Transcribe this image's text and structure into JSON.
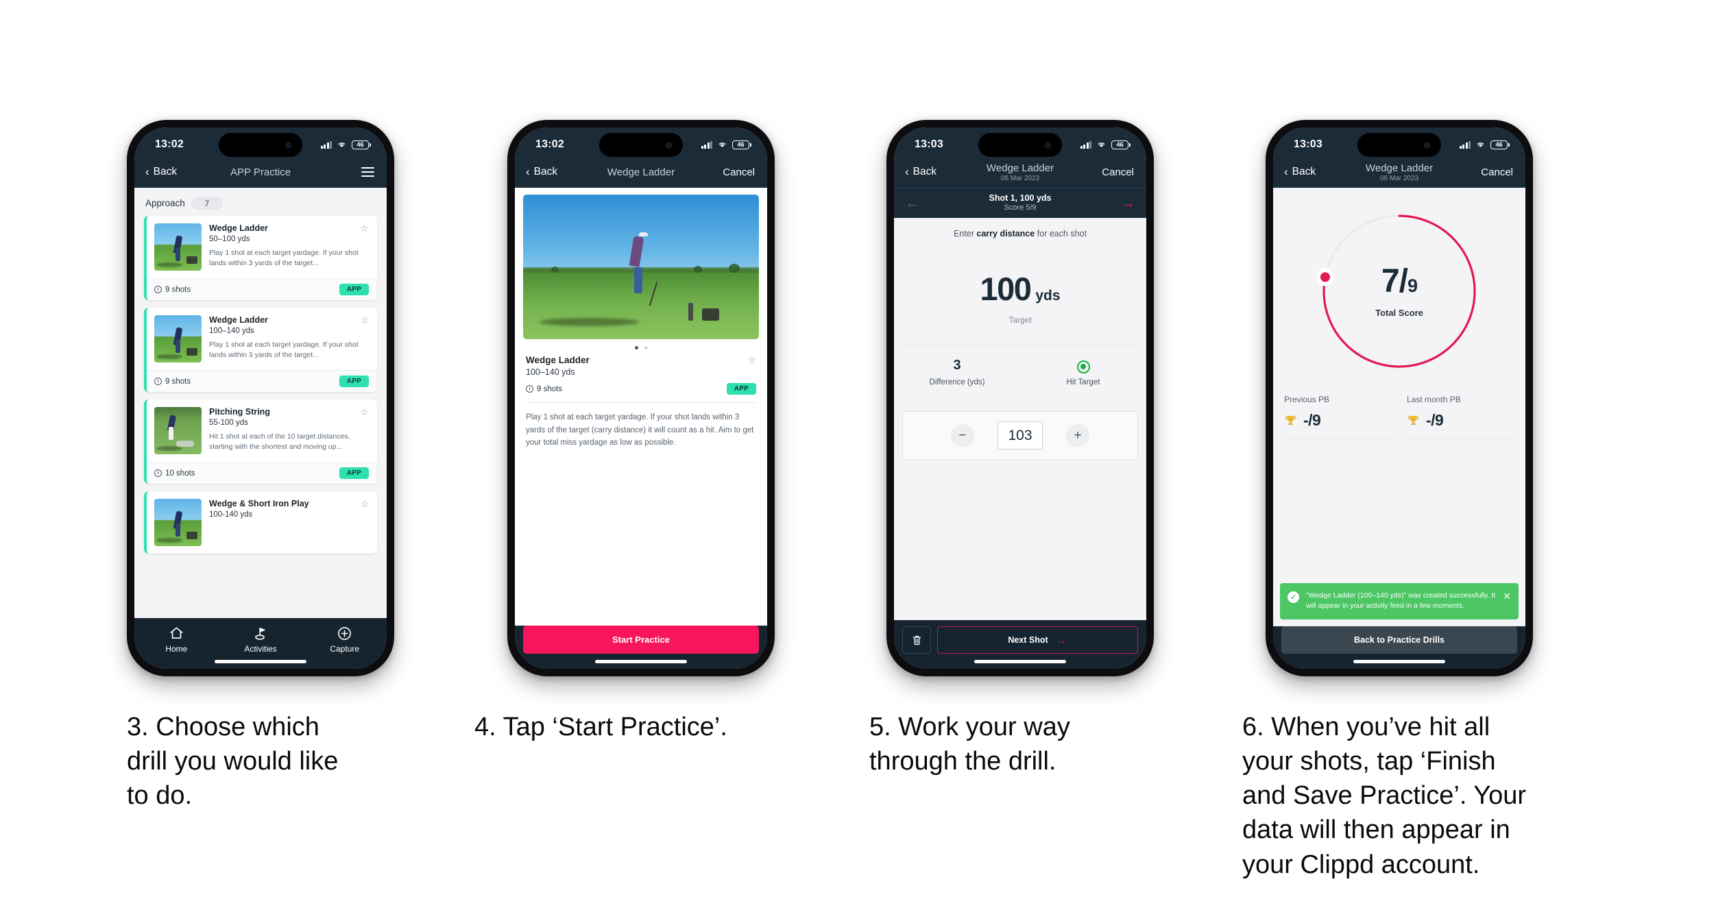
{
  "phone1": {
    "status": {
      "time": "13:02",
      "battery": "46"
    },
    "nav": {
      "back": "Back",
      "title": "APP Practice",
      "menu_icon": "hamburger-icon"
    },
    "section": {
      "label": "Approach",
      "count": "7"
    },
    "cards": [
      {
        "title": "Wedge Ladder",
        "range": "50–100 yds",
        "desc": "Play 1 shot at each target yardage. If your shot lands within 3 yards of the target...",
        "shots": "9 shots",
        "tag": "APP"
      },
      {
        "title": "Wedge Ladder",
        "range": "100–140 yds",
        "desc": "Play 1 shot at each target yardage. If your shot lands within 3 yards of the target...",
        "shots": "9 shots",
        "tag": "APP"
      },
      {
        "title": "Pitching String",
        "range": "55-100 yds",
        "desc": "Hit 1 shot at each of the 10 target distances, starting with the shortest and moving up...",
        "shots": "10 shots",
        "tag": "APP"
      },
      {
        "title": "Wedge & Short Iron Play",
        "range": "100-140 yds",
        "desc": "",
        "shots": "",
        "tag": ""
      }
    ],
    "tabs": [
      {
        "label": "Home",
        "icon": "home-icon"
      },
      {
        "label": "Activities",
        "icon": "golf-flag-icon"
      },
      {
        "label": "Capture",
        "icon": "plus-circle-icon"
      }
    ]
  },
  "phone2": {
    "status": {
      "time": "13:02",
      "battery": "46"
    },
    "nav": {
      "back": "Back",
      "title": "Wedge Ladder",
      "cancel": "Cancel"
    },
    "detail": {
      "title": "Wedge Ladder",
      "range": "100–140 yds",
      "shots": "9 shots",
      "tag": "APP",
      "description": "Play 1 shot at each target yardage. If your shot lands within 3 yards of the target (carry distance) it will count as a hit. Aim to get your total miss yardage as low as possible."
    },
    "cta": "Start Practice"
  },
  "phone3": {
    "status": {
      "time": "13:03",
      "battery": "46"
    },
    "nav": {
      "back": "Back",
      "title": "Wedge Ladder",
      "subtitle": "06 Mar 2023",
      "cancel": "Cancel"
    },
    "shot_strip": {
      "title": "Shot 1, 100 yds",
      "score": "Score 5/9"
    },
    "hint_prefix": "Enter ",
    "hint_bold": "carry distance",
    "hint_suffix": " for each shot",
    "target": {
      "value": "100",
      "unit": "yds",
      "label": "Target"
    },
    "stats": [
      {
        "value": "3",
        "label": "Difference (yds)"
      },
      {
        "value": "",
        "label": "Hit Target",
        "icon": "target-hit-icon"
      }
    ],
    "stepper": {
      "minus": "−",
      "value": "103",
      "plus": "+"
    },
    "footer": {
      "delete_icon": "trash-icon",
      "next": "Next Shot",
      "next_arrow": "arrow-right-icon"
    }
  },
  "phone4": {
    "status": {
      "time": "13:03",
      "battery": "46"
    },
    "nav": {
      "back": "Back",
      "title": "Wedge Ladder",
      "subtitle": "06 Mar 2023",
      "cancel": "Cancel"
    },
    "ring": {
      "score": "7",
      "separator": "/",
      "denominator": "9",
      "label": "Total Score",
      "progress": 0.78,
      "color": "#e2194f"
    },
    "pbs": [
      {
        "label": "Previous PB",
        "value": "-/9",
        "icon": "trophy-icon"
      },
      {
        "label": "Last month PB",
        "value": "-/9",
        "icon": "trophy-icon"
      }
    ],
    "toast": {
      "text": "\"Wedge Ladder (100–140 yds)\" was created successfully. It will appear in your activity feed in a few moments.",
      "check_icon": "check-circle-icon",
      "close_icon": "close-icon",
      "color": "#4cc764"
    },
    "button": "Back to Practice Drills"
  },
  "captions": [
    "3. Choose which\ndrill you would like\nto do.",
    "4. Tap ‘Start Practice’.",
    "5. Work your way\nthrough the drill.",
    "6. When you’ve hit all\nyour shots, tap ‘Finish\nand Save Practice’. Your\ndata will then appear in\nyour Clippd account."
  ]
}
